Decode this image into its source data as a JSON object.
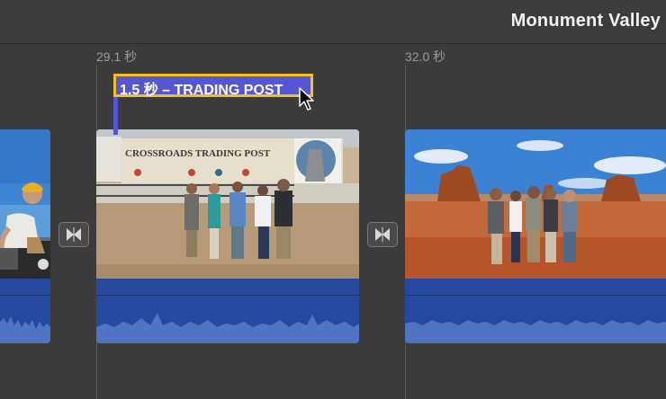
{
  "project": {
    "title": "Monument Valley"
  },
  "timeline": {
    "time_markers": [
      "29.1 秒",
      "32.0 秒"
    ]
  },
  "title_clip": {
    "label": "1.5 秒 – TRADING POST"
  },
  "clips": {
    "middle": {
      "sign_text": "CROSSROADS TRADING POST"
    }
  },
  "icons": {
    "transition": "bowtie-transition-icon",
    "cursor": "arrow-cursor-icon"
  },
  "colors": {
    "audio": "#2649a0",
    "title_clip": "#5656d4",
    "selection": "#f5c018"
  }
}
